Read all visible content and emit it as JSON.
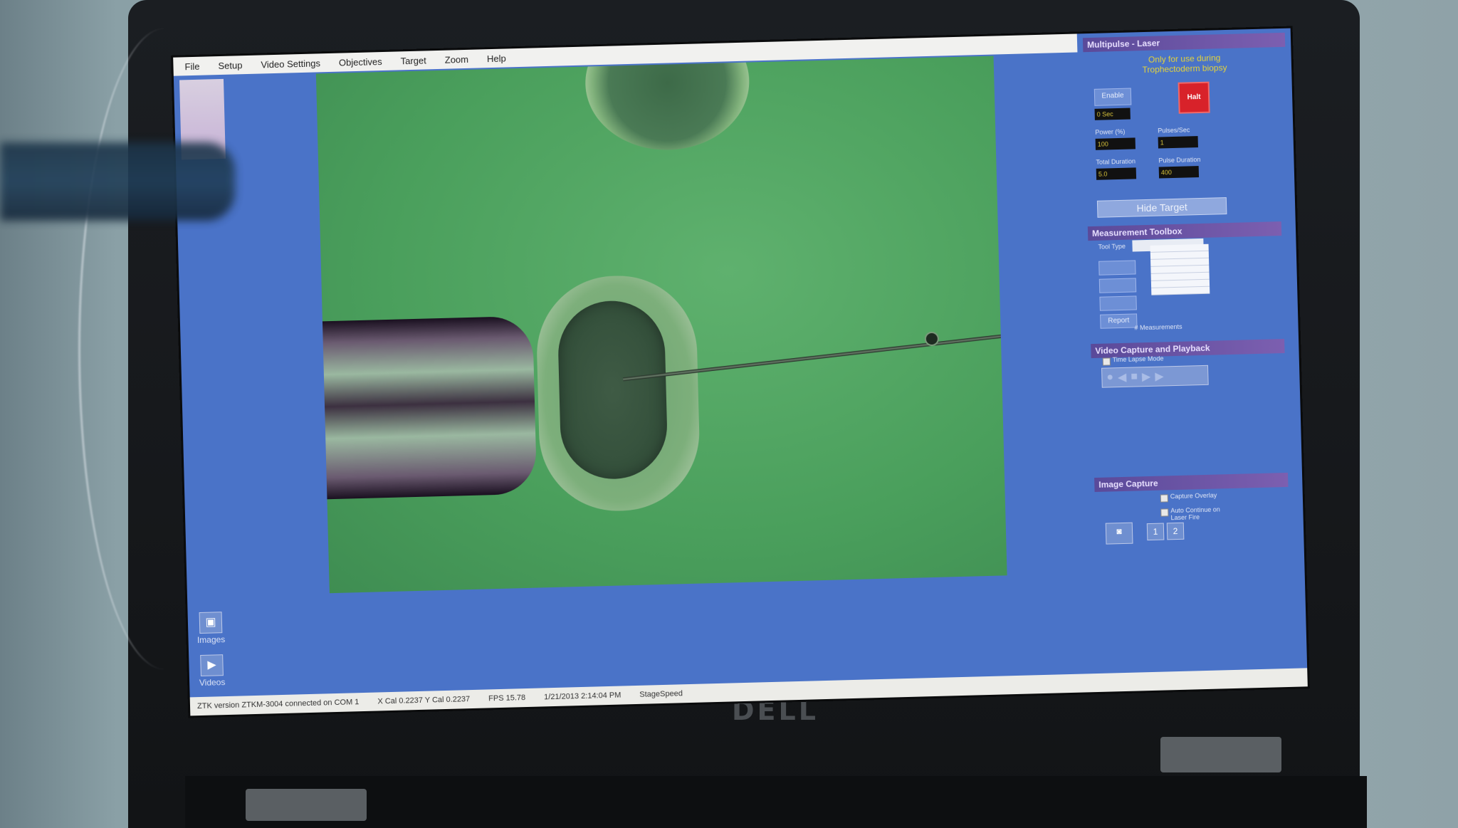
{
  "menu": [
    "File",
    "Setup",
    "Video Settings",
    "Objectives",
    "Target",
    "Zoom",
    "Help"
  ],
  "panel": {
    "title": "Multipulse - Laser",
    "subtitle_line1": "Only for use during",
    "subtitle_line2": "Trophectoderm biopsy",
    "enable_label": "Enable",
    "timer_value": "0 Sec",
    "halt_label": "Halt",
    "power_label": "Power (%)",
    "power_value": "100",
    "pulses_label": "Pulses/Sec",
    "pulses_value": "1",
    "total_label": "Total Duration",
    "total_value": "5.0",
    "pulse_dur_label": "Pulse Duration",
    "pulse_dur_value": "400",
    "target_btn": "Hide Target"
  },
  "measure": {
    "title": "Measurement Toolbox",
    "tool_type_label": "Tool Type",
    "report_btn": "Report",
    "measurements_label": "# Measurements"
  },
  "video": {
    "title": "Video Capture and Playback",
    "timelapse_label": "Time Lapse Mode"
  },
  "capture": {
    "title": "Image Capture",
    "capture_overlay": "Capture Overlay",
    "autocontinue_label": "Auto Continue on Laser Fire",
    "btn1": "1",
    "btn2": "2"
  },
  "left": {
    "images_label": "Images",
    "videos_label": "Videos"
  },
  "status": {
    "version": "ZTK version ZTKM-3004  connected on COM 1",
    "coords": "X Cal 0.2237  Y Cal 0.2237",
    "fps": "FPS 15.78",
    "datetime": "1/21/2013 2:14:04 PM",
    "stage": "StageSpeed"
  },
  "brand": "DELL"
}
